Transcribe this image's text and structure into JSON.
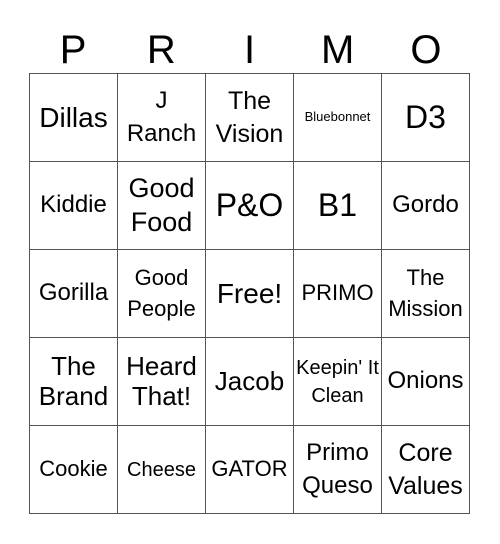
{
  "header": {
    "letters": [
      "P",
      "R",
      "I",
      "M",
      "O"
    ]
  },
  "cells": [
    [
      "Dillas",
      "J Ranch",
      "The Vision",
      "Bluebonnet",
      "D3"
    ],
    [
      "Kiddie",
      "Good Food",
      "P&O",
      "B1",
      "Gordo"
    ],
    [
      "Gorilla",
      "Good People",
      "Free!",
      "PRIMO",
      "The Mission"
    ],
    [
      "The Brand",
      "Heard That!",
      "Jacob",
      "Keepin' It Clean",
      "Onions"
    ],
    [
      "Cookie",
      "Cheese",
      "GATOR",
      "Primo Queso",
      "Core Values"
    ]
  ]
}
